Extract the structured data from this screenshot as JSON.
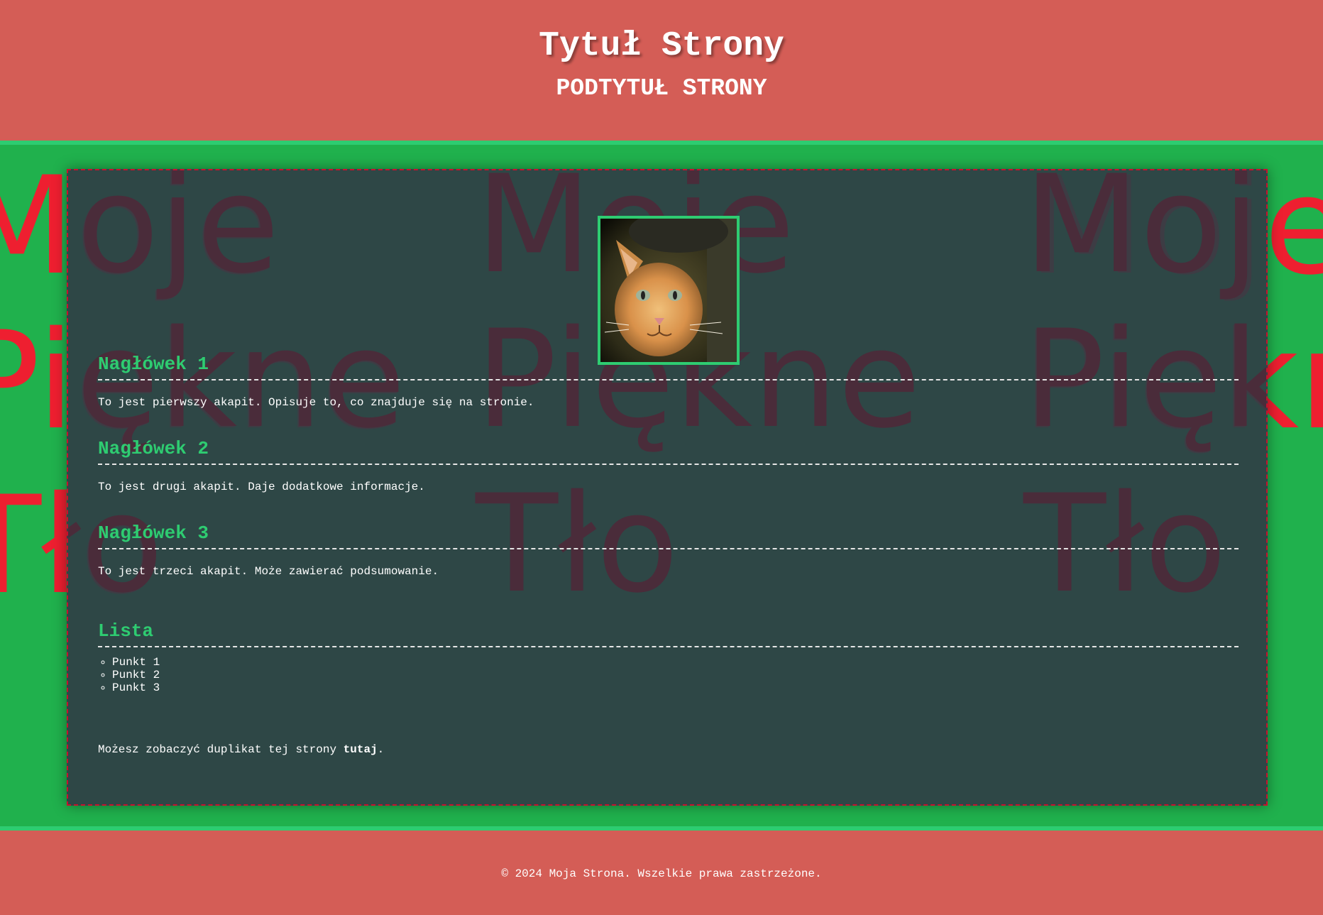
{
  "header": {
    "title": "Tytuł Strony",
    "subtitle": "PODTYTUŁ STRONY"
  },
  "background": {
    "words": [
      "Moje",
      "Piękne",
      "Tło"
    ]
  },
  "main": {
    "photo_alt": "cat",
    "sections": [
      {
        "heading": "Nagłówek 1",
        "text": "To jest pierwszy akapit. Opisuje to, co znajduje się na stronie."
      },
      {
        "heading": "Nagłówek 2",
        "text": "To jest drugi akapit. Daje dodatkowe informacje."
      },
      {
        "heading": "Nagłówek 3",
        "text": "To jest trzeci akapit. Może zawierać podsumowanie."
      }
    ],
    "list": {
      "heading": "Lista",
      "items": [
        "Punkt 1",
        "Punkt 2",
        "Punkt 3"
      ]
    },
    "duplicate": {
      "text": "Możesz zobaczyć duplikat tej strony ",
      "link": "tutaj",
      "suffix": "."
    }
  },
  "footer": {
    "text": "© 2024 Moja Strona. Wszelkie prawa zastrzeżone."
  }
}
